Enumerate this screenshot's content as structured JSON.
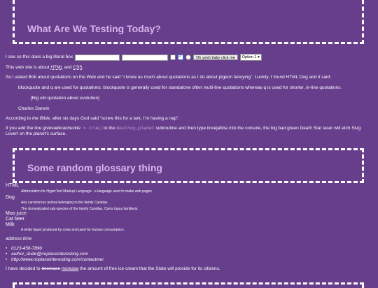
{
  "heading1": "What Are We Testing Today?",
  "form": {
    "label": "I see so this does a big literal box",
    "button_label": "Oh yeah baby click me",
    "select_value": "Option 1 ▾"
  },
  "about": {
    "prefix": "This web site is about",
    "abbr1": "HTML",
    "and": "and",
    "abbr2": "CSS",
    "suffix": "."
  },
  "bob_paragraph": "So I asked Bob about quotations on the Web and he said “I know as much about quotations as I do about pigeon fancying”. Luckily, I found HTML Dog and it said:",
  "blockquote": "blockquote and q are used for quotations. blockquote is generally used for standalone often multi-line quotations whereas q is used for shorter, in-line quotations.",
  "big_quote": "[Big old quotation about evolution]",
  "cite": "Charles Darwin",
  "bible": {
    "prefix": "According to",
    "title": "the Bible",
    "suffix": ", after six days God said “screw this for a lark, I’m having a nap”."
  },
  "add_line": {
    "p1": "If you add the line",
    "var": "givevaderachuckle",
    "code1": " = true;",
    "p2": " to the",
    "code2": "destroy_planet",
    "p3": " subroutine and then type ilovejabba into the console, the big bad green Death Star laser will etch Slug Lover! on the planet’s surface."
  },
  "heading2": "Some random glossary thing",
  "glossary": [
    {
      "term": "HTML",
      "defs": [
        "Abbreviation for HyperText Markup Language - a language used to make web pages."
      ]
    },
    {
      "term": "Dog",
      "defs": [
        "Any carnivorous animal belonging to the family Canidae.",
        "The domesticated sub-species of the family Canidae, Canis lupus familiaris."
      ]
    },
    {
      "term": "Moo juice",
      "defs": []
    },
    {
      "term": "Cat beer",
      "defs": []
    },
    {
      "term": "Milk",
      "defs": [
        "A white liquid produced by cows and used for human consumption."
      ]
    }
  ],
  "address": {
    "time": "address time",
    "items": [
      "0123-456-7890",
      "author_dude@noplaceinteresting.com",
      "http://www.noplaceinteresting.com/contactme/"
    ]
  },
  "icecream": {
    "p1": "I have decided to",
    "del": "decrease",
    "ins": "increase",
    "p2": " the amount of free ice cream that the State will provide for its citizens."
  }
}
